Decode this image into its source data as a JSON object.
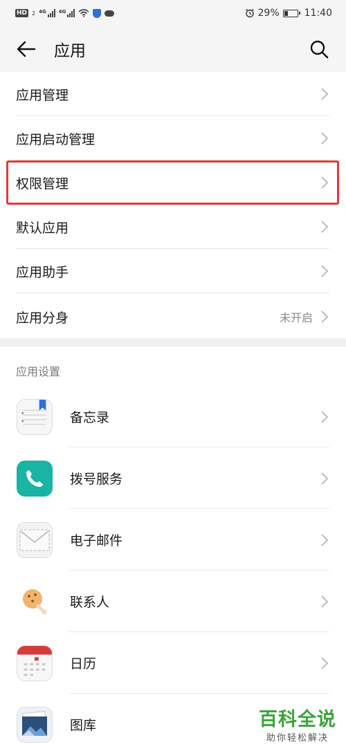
{
  "status_bar": {
    "hd": "HD",
    "sim1": "2",
    "net1": "4G",
    "net2": "4G",
    "battery_text": "29%",
    "battery_level": 0.29,
    "time": "11:40"
  },
  "header": {
    "title": "应用"
  },
  "menu": {
    "items": [
      {
        "label": "应用管理",
        "value": ""
      },
      {
        "label": "应用启动管理",
        "value": ""
      },
      {
        "label": "权限管理",
        "value": ""
      },
      {
        "label": "默认应用",
        "value": ""
      },
      {
        "label": "应用助手",
        "value": ""
      },
      {
        "label": "应用分身",
        "value": "未开启"
      }
    ]
  },
  "section": {
    "title": "应用设置"
  },
  "apps": {
    "items": [
      {
        "label": "备忘录",
        "icon": "notepad-icon"
      },
      {
        "label": "拨号服务",
        "icon": "phone-icon"
      },
      {
        "label": "电子邮件",
        "icon": "mail-icon"
      },
      {
        "label": "联系人",
        "icon": "contacts-icon"
      },
      {
        "label": "日历",
        "icon": "calendar-icon"
      },
      {
        "label": "图库",
        "icon": "gallery-icon"
      }
    ]
  },
  "watermark": {
    "main": "百科全说",
    "sub": "助你轻松解决"
  },
  "colors": {
    "highlight": "#e53935",
    "phone": "#18b4a4",
    "calendar": "#d63b3b",
    "watermark": "#3aa53a"
  }
}
